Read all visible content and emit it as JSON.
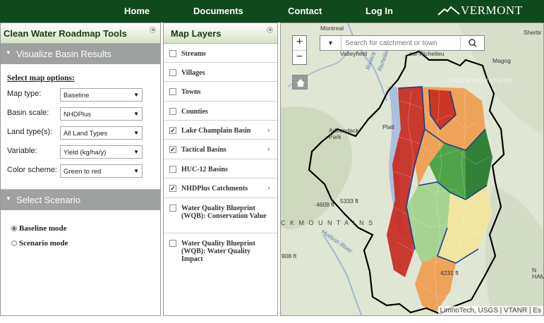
{
  "nav": {
    "home": "Home",
    "documents": "Documents",
    "contact": "Contact",
    "login": "Log In",
    "logo_text": "VERMONT"
  },
  "tools": {
    "title": "Clean Water Roadmap Tools",
    "visualize_label": "Visualize Basin Results",
    "select_options_label": "Select map options:",
    "options": [
      {
        "label": "Map type:",
        "value": "Baseline"
      },
      {
        "label": "Basin scale:",
        "value": "NHDPlus"
      },
      {
        "label": "Land type(s):",
        "value": "All Land Types"
      },
      {
        "label": "Variable:",
        "value": "Yield (kg/ha/y)"
      },
      {
        "label": "Color scheme:",
        "value": "Green to red"
      }
    ],
    "scenario_label": "Select Scenario",
    "modes": [
      {
        "label": "Baseline mode",
        "checked": true
      },
      {
        "label": "Scenario mode",
        "checked": false
      }
    ]
  },
  "layers": {
    "title": "Map Layers",
    "items": [
      {
        "label": "Streams",
        "checked": false,
        "expandable": false
      },
      {
        "label": "Villages",
        "checked": false,
        "expandable": false
      },
      {
        "label": "Towns",
        "checked": false,
        "expandable": false
      },
      {
        "label": "Counties",
        "checked": false,
        "expandable": false
      },
      {
        "label": "Lake Champlain Basin",
        "checked": true,
        "expandable": true
      },
      {
        "label": "Tactical Basins",
        "checked": true,
        "expandable": true
      },
      {
        "label": "HUC-12 Basins",
        "checked": false,
        "expandable": false
      },
      {
        "label": "NHDPlus Catchments",
        "checked": true,
        "expandable": true
      },
      {
        "label": "Water Quality Blueprint (WQB): Conservation Value",
        "checked": false,
        "expandable": false
      },
      {
        "label": "Water Quality Blueprint (WQB): Water Quality Impact",
        "checked": false,
        "expandable": false
      }
    ]
  },
  "map": {
    "search_placeholder": "Search for catchment or town",
    "zoom_in": "+",
    "zoom_out": "−",
    "attribution": "LimnoTech, USGS | VTANR | Es",
    "labels": {
      "montreal": "Montreal",
      "sherbrooke": "Sherbr",
      "valleyfield": "Valleyfield",
      "richelieu": "sur-Richelieu",
      "magog": "Magog",
      "green_mountains": "GREEN MOUNTAINS",
      "adirondack": "Adirondack Park",
      "plattsburgh": "Platt",
      "elev_4609": "4609 ft",
      "elev_5333": "5333 ft",
      "adirondack_mtns": "C K   M O U N T A I N S",
      "hudson": "Hudson River",
      "elev_908": "908 ft",
      "elev_4231": "4231 ft",
      "new_hampshire": "N\nHAM",
      "riviere": "Rivière",
      "champlain_riv": "Richelieu"
    },
    "colors": {
      "red": "#c62a1f",
      "orange": "#f09b4c",
      "yellow": "#f2e59a",
      "lightgreen": "#9fd088",
      "green": "#3f9b3a",
      "darkgreen": "#1f6b2a"
    }
  }
}
